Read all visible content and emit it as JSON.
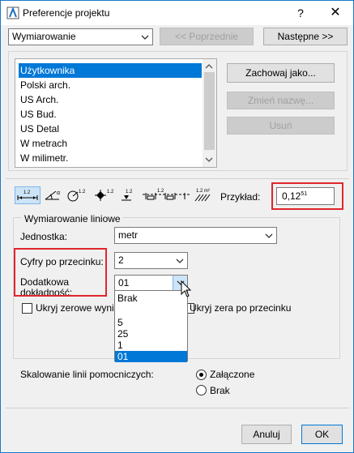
{
  "window": {
    "title": "Preferencje projektu",
    "help": "?",
    "close": "✕"
  },
  "top": {
    "category_select": "Wymiarowanie",
    "prev_button": "<< Poprzednie",
    "next_button": "Następne >>"
  },
  "schemes": {
    "items": [
      "Użytkownika",
      "Polski arch.",
      "US Arch.",
      "US Bud.",
      "US Detal",
      "W metrach",
      "W milimetr."
    ],
    "selected": "Użytkownika",
    "save_as": "Zachowaj jako...",
    "rename": "Zmień nazwę...",
    "delete": "Usuń"
  },
  "toolbar": {
    "icons": [
      "linear-dimension-icon",
      "angular-dimension-icon",
      "radial-dimension-icon",
      "level-dimension-icon",
      "elevation-dimension-icon",
      "door-window-dimension-icon",
      "area-dimension-icon"
    ],
    "example_label": "Przykład:",
    "example_value": "0,12",
    "example_sup": "51"
  },
  "linear": {
    "group_title": "Wymiarowanie liniowe",
    "unit_label": "Jednostka:",
    "unit_value": "metr",
    "decimals_label": "Cyfry po przecinku:",
    "decimals_value": "2",
    "extra_precision_label_1": "Dodatkowa",
    "extra_precision_label_2": "dokładność:",
    "extra_precision_value": "01",
    "extra_precision_options": [
      "Brak",
      "",
      "5",
      "25",
      "1",
      "01"
    ],
    "hide_zero_whole": "Ukryj zerowe wynik",
    "hide_zero_decimals": "Ukryj zera po przecinku"
  },
  "aux_lines": {
    "label": "Skalowanie linii pomocniczych:",
    "on": "Załączone",
    "off": "Brak",
    "selected": "on"
  },
  "footer": {
    "cancel": "Anuluj",
    "ok": "OK"
  }
}
